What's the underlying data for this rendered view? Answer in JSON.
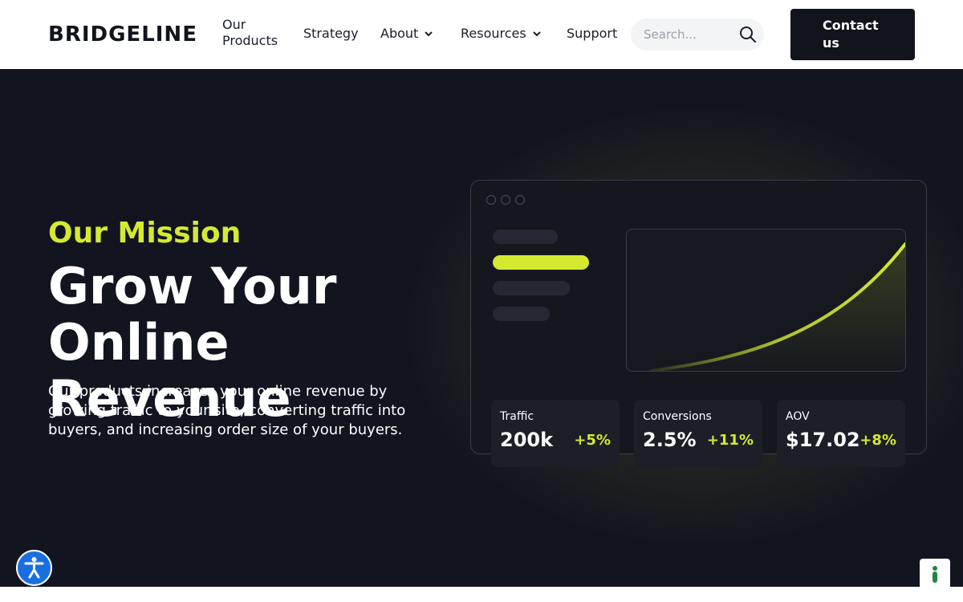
{
  "header": {
    "logo": "BRIDGELINE",
    "nav": [
      {
        "label": "Our Products"
      },
      {
        "label": "Strategy"
      },
      {
        "label": "About",
        "has_dropdown": true
      },
      {
        "label": "Resources",
        "has_dropdown": true
      },
      {
        "label": "Support"
      }
    ],
    "search": {
      "placeholder": "Search...",
      "value": ""
    },
    "contact_label": "Contact us"
  },
  "hero": {
    "eyebrow": "Our Mission",
    "headline": "Grow Your Online Revenue",
    "description": "Our products increases your online revenue by growing traffic to your site, converting traffic into buyers, and increasing order size of your buyers.",
    "stats": [
      {
        "label": "Traffic",
        "value": "200k",
        "delta": "+5%"
      },
      {
        "label": "Conversions",
        "value": "2.5%",
        "delta": "+11%"
      },
      {
        "label": "AOV",
        "value": "$17.02",
        "delta": "+8%"
      }
    ]
  },
  "colors": {
    "accent": "#d4ea31",
    "hero_bg": "#121420",
    "header_text": "#1a1d2b",
    "contact_bg": "#11131d",
    "a11y_blue": "#1a6fe0",
    "cookie_green": "#1a8a3a"
  },
  "icons": {
    "search": "search-icon",
    "chevron": "chevron-down-icon",
    "accessibility": "accessibility-icon",
    "cookie": "cookie-settings-icon"
  }
}
